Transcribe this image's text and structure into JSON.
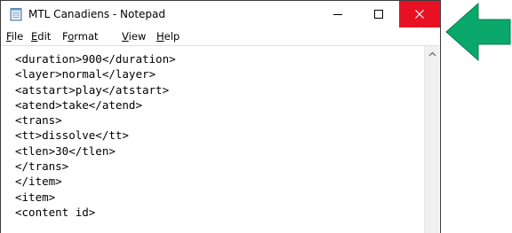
{
  "window": {
    "title": "MTL Canadiens - Notepad",
    "icon": "notepad-icon",
    "controls": {
      "minimize_icon": "minimize-icon",
      "maximize_icon": "maximize-icon",
      "close_icon": "close-icon",
      "close_color": "#e81123"
    }
  },
  "menu": {
    "items": [
      {
        "first": "F",
        "rest": "ile"
      },
      {
        "first": "E",
        "rest": "dit"
      },
      {
        "first": "F",
        "rest": "o",
        "alt": true,
        "mid": "r",
        "tail": "mat"
      },
      {
        "first": "V",
        "rest": "iew"
      },
      {
        "first": "H",
        "rest": "elp"
      }
    ]
  },
  "editor": {
    "lines": [
      "<duration>900</duration>",
      "<layer>normal</layer>",
      "<atstart>play</atstart>",
      "<atend>take</atend>",
      "<trans>",
      "<tt>dissolve</tt>",
      "<tlen>30</tlen>",
      "</trans>",
      "</item>",
      "<item>",
      "<content id>"
    ]
  },
  "annotation": {
    "arrow_color": "#0aa86a",
    "arrow_icon": "pointer-arrow-icon"
  }
}
